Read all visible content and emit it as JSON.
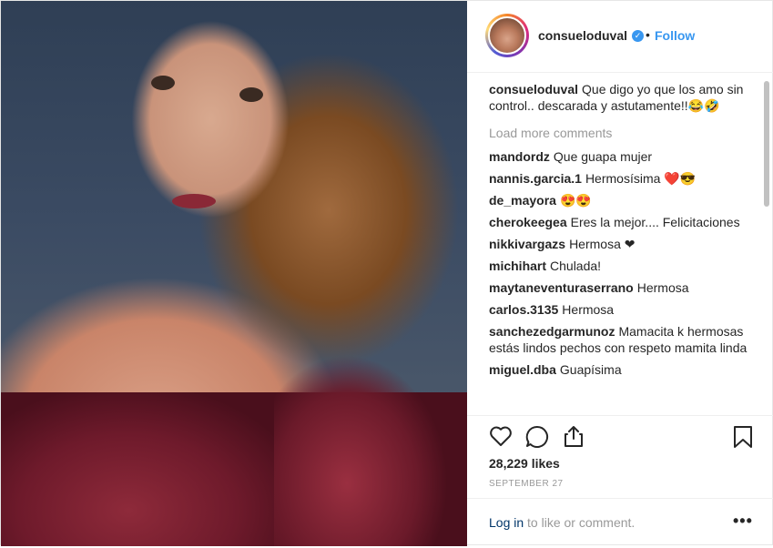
{
  "header": {
    "username": "consueloduval",
    "dot": "•",
    "follow_label": "Follow",
    "verified_glyph": "✓"
  },
  "caption": {
    "username": "consueloduval",
    "text": "Que digo yo que los amo sin control.. descarada y astutamente!!😂🤣"
  },
  "load_more_label": "Load more comments",
  "comments": [
    {
      "username": "mandordz",
      "text": "Que guapa mujer"
    },
    {
      "username": "nannis.garcia.1",
      "text": "Hermosísima ❤️😎"
    },
    {
      "username": "de_mayora",
      "text": "😍😍"
    },
    {
      "username": "cherokeegea",
      "text": "Eres la mejor.... Felicitaciones"
    },
    {
      "username": "nikkivargazs",
      "text": "Hermosa ❤"
    },
    {
      "username": "michihart",
      "text": "Chulada!"
    },
    {
      "username": "maytaneventuraserrano",
      "text": "Hermosa"
    },
    {
      "username": "carlos.3135",
      "text": "Hermosa"
    },
    {
      "username": "sanchezedgarmunoz",
      "text": "Mamacita k hermosas estás lindos pechos con respeto mamita linda"
    },
    {
      "username": "miguel.dba",
      "text": "Guapísima"
    }
  ],
  "likes_label": "28,229 likes",
  "date_label": "SEPTEMBER 27",
  "login": {
    "link_label": "Log in",
    "rest_label": " to like or comment."
  },
  "more_label": "•••",
  "colors": {
    "link_blue": "#3897f0",
    "text": "#262626",
    "muted": "#999999"
  },
  "icons": [
    "heart-icon",
    "comment-icon",
    "share-icon",
    "bookmark-icon",
    "verified-badge-icon",
    "more-options-icon"
  ]
}
